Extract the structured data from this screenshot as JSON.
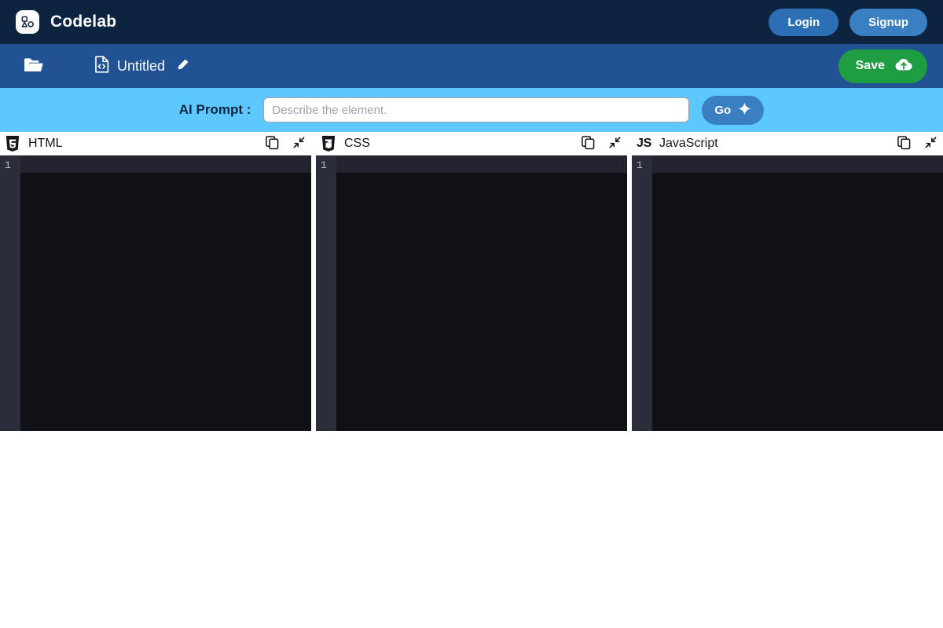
{
  "app": {
    "brand_name": "Codelab",
    "logo_icon": "shapes-logo-icon"
  },
  "topbar": {
    "login_label": "Login",
    "signup_label": "Signup",
    "background_color": "#0d2440",
    "login_color": "#2c6fb5",
    "signup_color": "#3a7fc2"
  },
  "toolbar": {
    "open_folder_icon": "folder-open-icon",
    "file_icon": "code-file-icon",
    "file_name": "Untitled",
    "edit_icon": "pencil-icon",
    "save_label": "Save",
    "save_icon": "cloud-upload-icon",
    "background_color": "#215294",
    "save_color": "#1f9d42"
  },
  "ai_bar": {
    "label": "AI Prompt :",
    "input_value": "",
    "input_placeholder": "Describe the element.",
    "go_label": "Go",
    "go_icon": "sparkle-icon",
    "background_color": "#5cc8fd",
    "go_color": "#3a7fc2"
  },
  "panes": [
    {
      "id": "html",
      "title": "HTML",
      "icon": "html5-shield-icon",
      "copy_icon": "copy-icon",
      "collapse_icon": "collapse-diagonal-icon",
      "line_numbers": [
        "1"
      ],
      "code": ""
    },
    {
      "id": "css",
      "title": "CSS",
      "icon": "css3-shield-icon",
      "copy_icon": "copy-icon",
      "collapse_icon": "collapse-diagonal-icon",
      "line_numbers": [
        "1"
      ],
      "code": ""
    },
    {
      "id": "javascript",
      "title": "JavaScript",
      "icon": "js-mark-icon",
      "copy_icon": "copy-icon",
      "collapse_icon": "collapse-diagonal-icon",
      "line_numbers": [
        "1"
      ],
      "code": ""
    }
  ],
  "editor_theme": {
    "background": "#0f1117",
    "gutter_background": "#2b2d3a",
    "active_line": "#23242f",
    "line_number_color": "#b8bcc8"
  }
}
